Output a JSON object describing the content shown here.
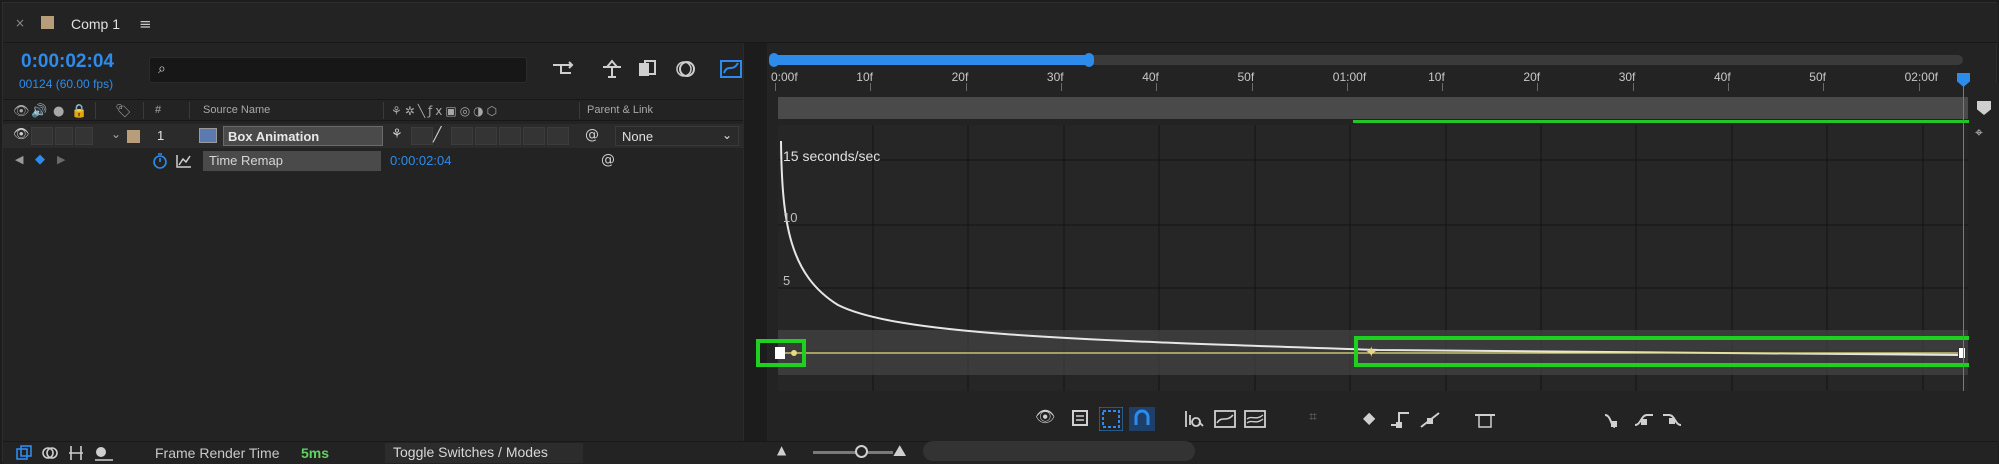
{
  "tab": {
    "close": "×",
    "title": "Comp 1",
    "menu": "≡",
    "swatch_color": "#b79d7a"
  },
  "header": {
    "timecode": "0:00:02:04",
    "fps": "00124 (60.00 fps)",
    "search_placeholder": ""
  },
  "columns": {
    "num": "#",
    "source_name": "Source Name",
    "parent_link": "Parent & Link"
  },
  "layer": {
    "index": "1",
    "name": "Box Animation",
    "parent": "None"
  },
  "property": {
    "name": "Time Remap",
    "value": "0:00:02:04"
  },
  "ruler": {
    "labels": [
      "0:00f",
      "10f",
      "20f",
      "30f",
      "40f",
      "50f",
      "01:00f",
      "10f",
      "20f",
      "30f",
      "40f",
      "50f",
      "02:00f"
    ]
  },
  "graph": {
    "speed_label": "15 seconds/sec",
    "y_labels": [
      "10",
      "5"
    ]
  },
  "bottom": {
    "frame_render_label": "Frame Render Time",
    "frame_render_value": "5ms",
    "toggle_label": "Toggle Switches / Modes"
  },
  "colors": {
    "accent": "#2d8ceb",
    "highlight": "#26c526",
    "keyframe_curve": "#e8d97a"
  }
}
